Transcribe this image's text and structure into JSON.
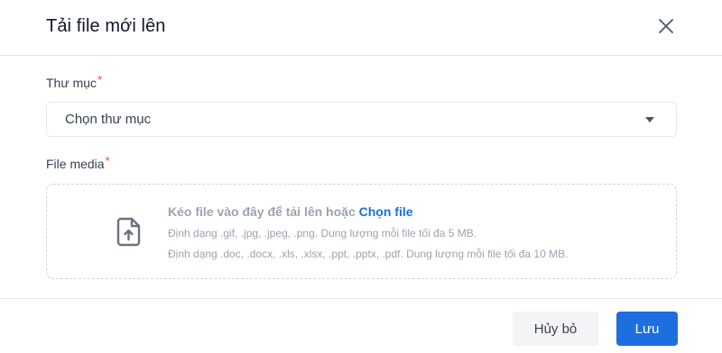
{
  "dialog": {
    "title": "Tải file mới lên",
    "close_icon": "close-icon"
  },
  "folder_field": {
    "label": "Thư mục",
    "required_mark": "*",
    "selected_value": "Chọn thư mục",
    "caret_icon": "caret-down-icon"
  },
  "media_field": {
    "label": "File media",
    "required_mark": "*",
    "upload_icon": "file-upload-icon",
    "drop_text": "Kéo file vào đây để tải lên hoặc",
    "choose_link": "Chọn file",
    "hint_images": "Định dạng .gif, .jpg, .jpeg, .png. Dung lượng mỗi file tối đa 5 MB.",
    "hint_documents": "Định dạng .doc, .docx, .xls, .xlsx, .ppt, .pptx, .pdf. Dung lượng mỗi file tối đa 10 MB."
  },
  "footer": {
    "cancel_label": "Hủy bỏ",
    "save_label": "Lưu"
  },
  "colors": {
    "primary": "#1d6fe0",
    "required": "#ef4444",
    "muted_text": "#9ca3af",
    "cancel_bg": "#f3f4f6"
  }
}
